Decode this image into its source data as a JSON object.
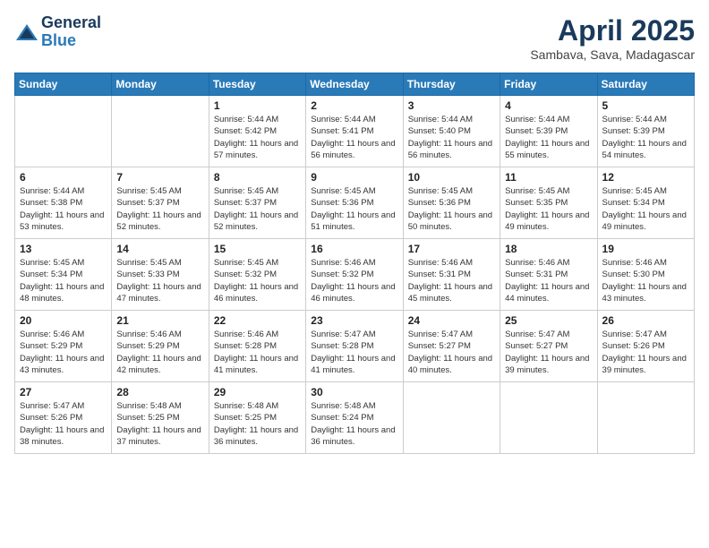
{
  "header": {
    "logo_line1": "General",
    "logo_line2": "Blue",
    "month_title": "April 2025",
    "location": "Sambava, Sava, Madagascar"
  },
  "days_of_week": [
    "Sunday",
    "Monday",
    "Tuesday",
    "Wednesday",
    "Thursday",
    "Friday",
    "Saturday"
  ],
  "weeks": [
    [
      {
        "day": "",
        "info": ""
      },
      {
        "day": "",
        "info": ""
      },
      {
        "day": "1",
        "info": "Sunrise: 5:44 AM\nSunset: 5:42 PM\nDaylight: 11 hours and 57 minutes."
      },
      {
        "day": "2",
        "info": "Sunrise: 5:44 AM\nSunset: 5:41 PM\nDaylight: 11 hours and 56 minutes."
      },
      {
        "day": "3",
        "info": "Sunrise: 5:44 AM\nSunset: 5:40 PM\nDaylight: 11 hours and 56 minutes."
      },
      {
        "day": "4",
        "info": "Sunrise: 5:44 AM\nSunset: 5:39 PM\nDaylight: 11 hours and 55 minutes."
      },
      {
        "day": "5",
        "info": "Sunrise: 5:44 AM\nSunset: 5:39 PM\nDaylight: 11 hours and 54 minutes."
      }
    ],
    [
      {
        "day": "6",
        "info": "Sunrise: 5:44 AM\nSunset: 5:38 PM\nDaylight: 11 hours and 53 minutes."
      },
      {
        "day": "7",
        "info": "Sunrise: 5:45 AM\nSunset: 5:37 PM\nDaylight: 11 hours and 52 minutes."
      },
      {
        "day": "8",
        "info": "Sunrise: 5:45 AM\nSunset: 5:37 PM\nDaylight: 11 hours and 52 minutes."
      },
      {
        "day": "9",
        "info": "Sunrise: 5:45 AM\nSunset: 5:36 PM\nDaylight: 11 hours and 51 minutes."
      },
      {
        "day": "10",
        "info": "Sunrise: 5:45 AM\nSunset: 5:36 PM\nDaylight: 11 hours and 50 minutes."
      },
      {
        "day": "11",
        "info": "Sunrise: 5:45 AM\nSunset: 5:35 PM\nDaylight: 11 hours and 49 minutes."
      },
      {
        "day": "12",
        "info": "Sunrise: 5:45 AM\nSunset: 5:34 PM\nDaylight: 11 hours and 49 minutes."
      }
    ],
    [
      {
        "day": "13",
        "info": "Sunrise: 5:45 AM\nSunset: 5:34 PM\nDaylight: 11 hours and 48 minutes."
      },
      {
        "day": "14",
        "info": "Sunrise: 5:45 AM\nSunset: 5:33 PM\nDaylight: 11 hours and 47 minutes."
      },
      {
        "day": "15",
        "info": "Sunrise: 5:45 AM\nSunset: 5:32 PM\nDaylight: 11 hours and 46 minutes."
      },
      {
        "day": "16",
        "info": "Sunrise: 5:46 AM\nSunset: 5:32 PM\nDaylight: 11 hours and 46 minutes."
      },
      {
        "day": "17",
        "info": "Sunrise: 5:46 AM\nSunset: 5:31 PM\nDaylight: 11 hours and 45 minutes."
      },
      {
        "day": "18",
        "info": "Sunrise: 5:46 AM\nSunset: 5:31 PM\nDaylight: 11 hours and 44 minutes."
      },
      {
        "day": "19",
        "info": "Sunrise: 5:46 AM\nSunset: 5:30 PM\nDaylight: 11 hours and 43 minutes."
      }
    ],
    [
      {
        "day": "20",
        "info": "Sunrise: 5:46 AM\nSunset: 5:29 PM\nDaylight: 11 hours and 43 minutes."
      },
      {
        "day": "21",
        "info": "Sunrise: 5:46 AM\nSunset: 5:29 PM\nDaylight: 11 hours and 42 minutes."
      },
      {
        "day": "22",
        "info": "Sunrise: 5:46 AM\nSunset: 5:28 PM\nDaylight: 11 hours and 41 minutes."
      },
      {
        "day": "23",
        "info": "Sunrise: 5:47 AM\nSunset: 5:28 PM\nDaylight: 11 hours and 41 minutes."
      },
      {
        "day": "24",
        "info": "Sunrise: 5:47 AM\nSunset: 5:27 PM\nDaylight: 11 hours and 40 minutes."
      },
      {
        "day": "25",
        "info": "Sunrise: 5:47 AM\nSunset: 5:27 PM\nDaylight: 11 hours and 39 minutes."
      },
      {
        "day": "26",
        "info": "Sunrise: 5:47 AM\nSunset: 5:26 PM\nDaylight: 11 hours and 39 minutes."
      }
    ],
    [
      {
        "day": "27",
        "info": "Sunrise: 5:47 AM\nSunset: 5:26 PM\nDaylight: 11 hours and 38 minutes."
      },
      {
        "day": "28",
        "info": "Sunrise: 5:48 AM\nSunset: 5:25 PM\nDaylight: 11 hours and 37 minutes."
      },
      {
        "day": "29",
        "info": "Sunrise: 5:48 AM\nSunset: 5:25 PM\nDaylight: 11 hours and 36 minutes."
      },
      {
        "day": "30",
        "info": "Sunrise: 5:48 AM\nSunset: 5:24 PM\nDaylight: 11 hours and 36 minutes."
      },
      {
        "day": "",
        "info": ""
      },
      {
        "day": "",
        "info": ""
      },
      {
        "day": "",
        "info": ""
      }
    ]
  ]
}
